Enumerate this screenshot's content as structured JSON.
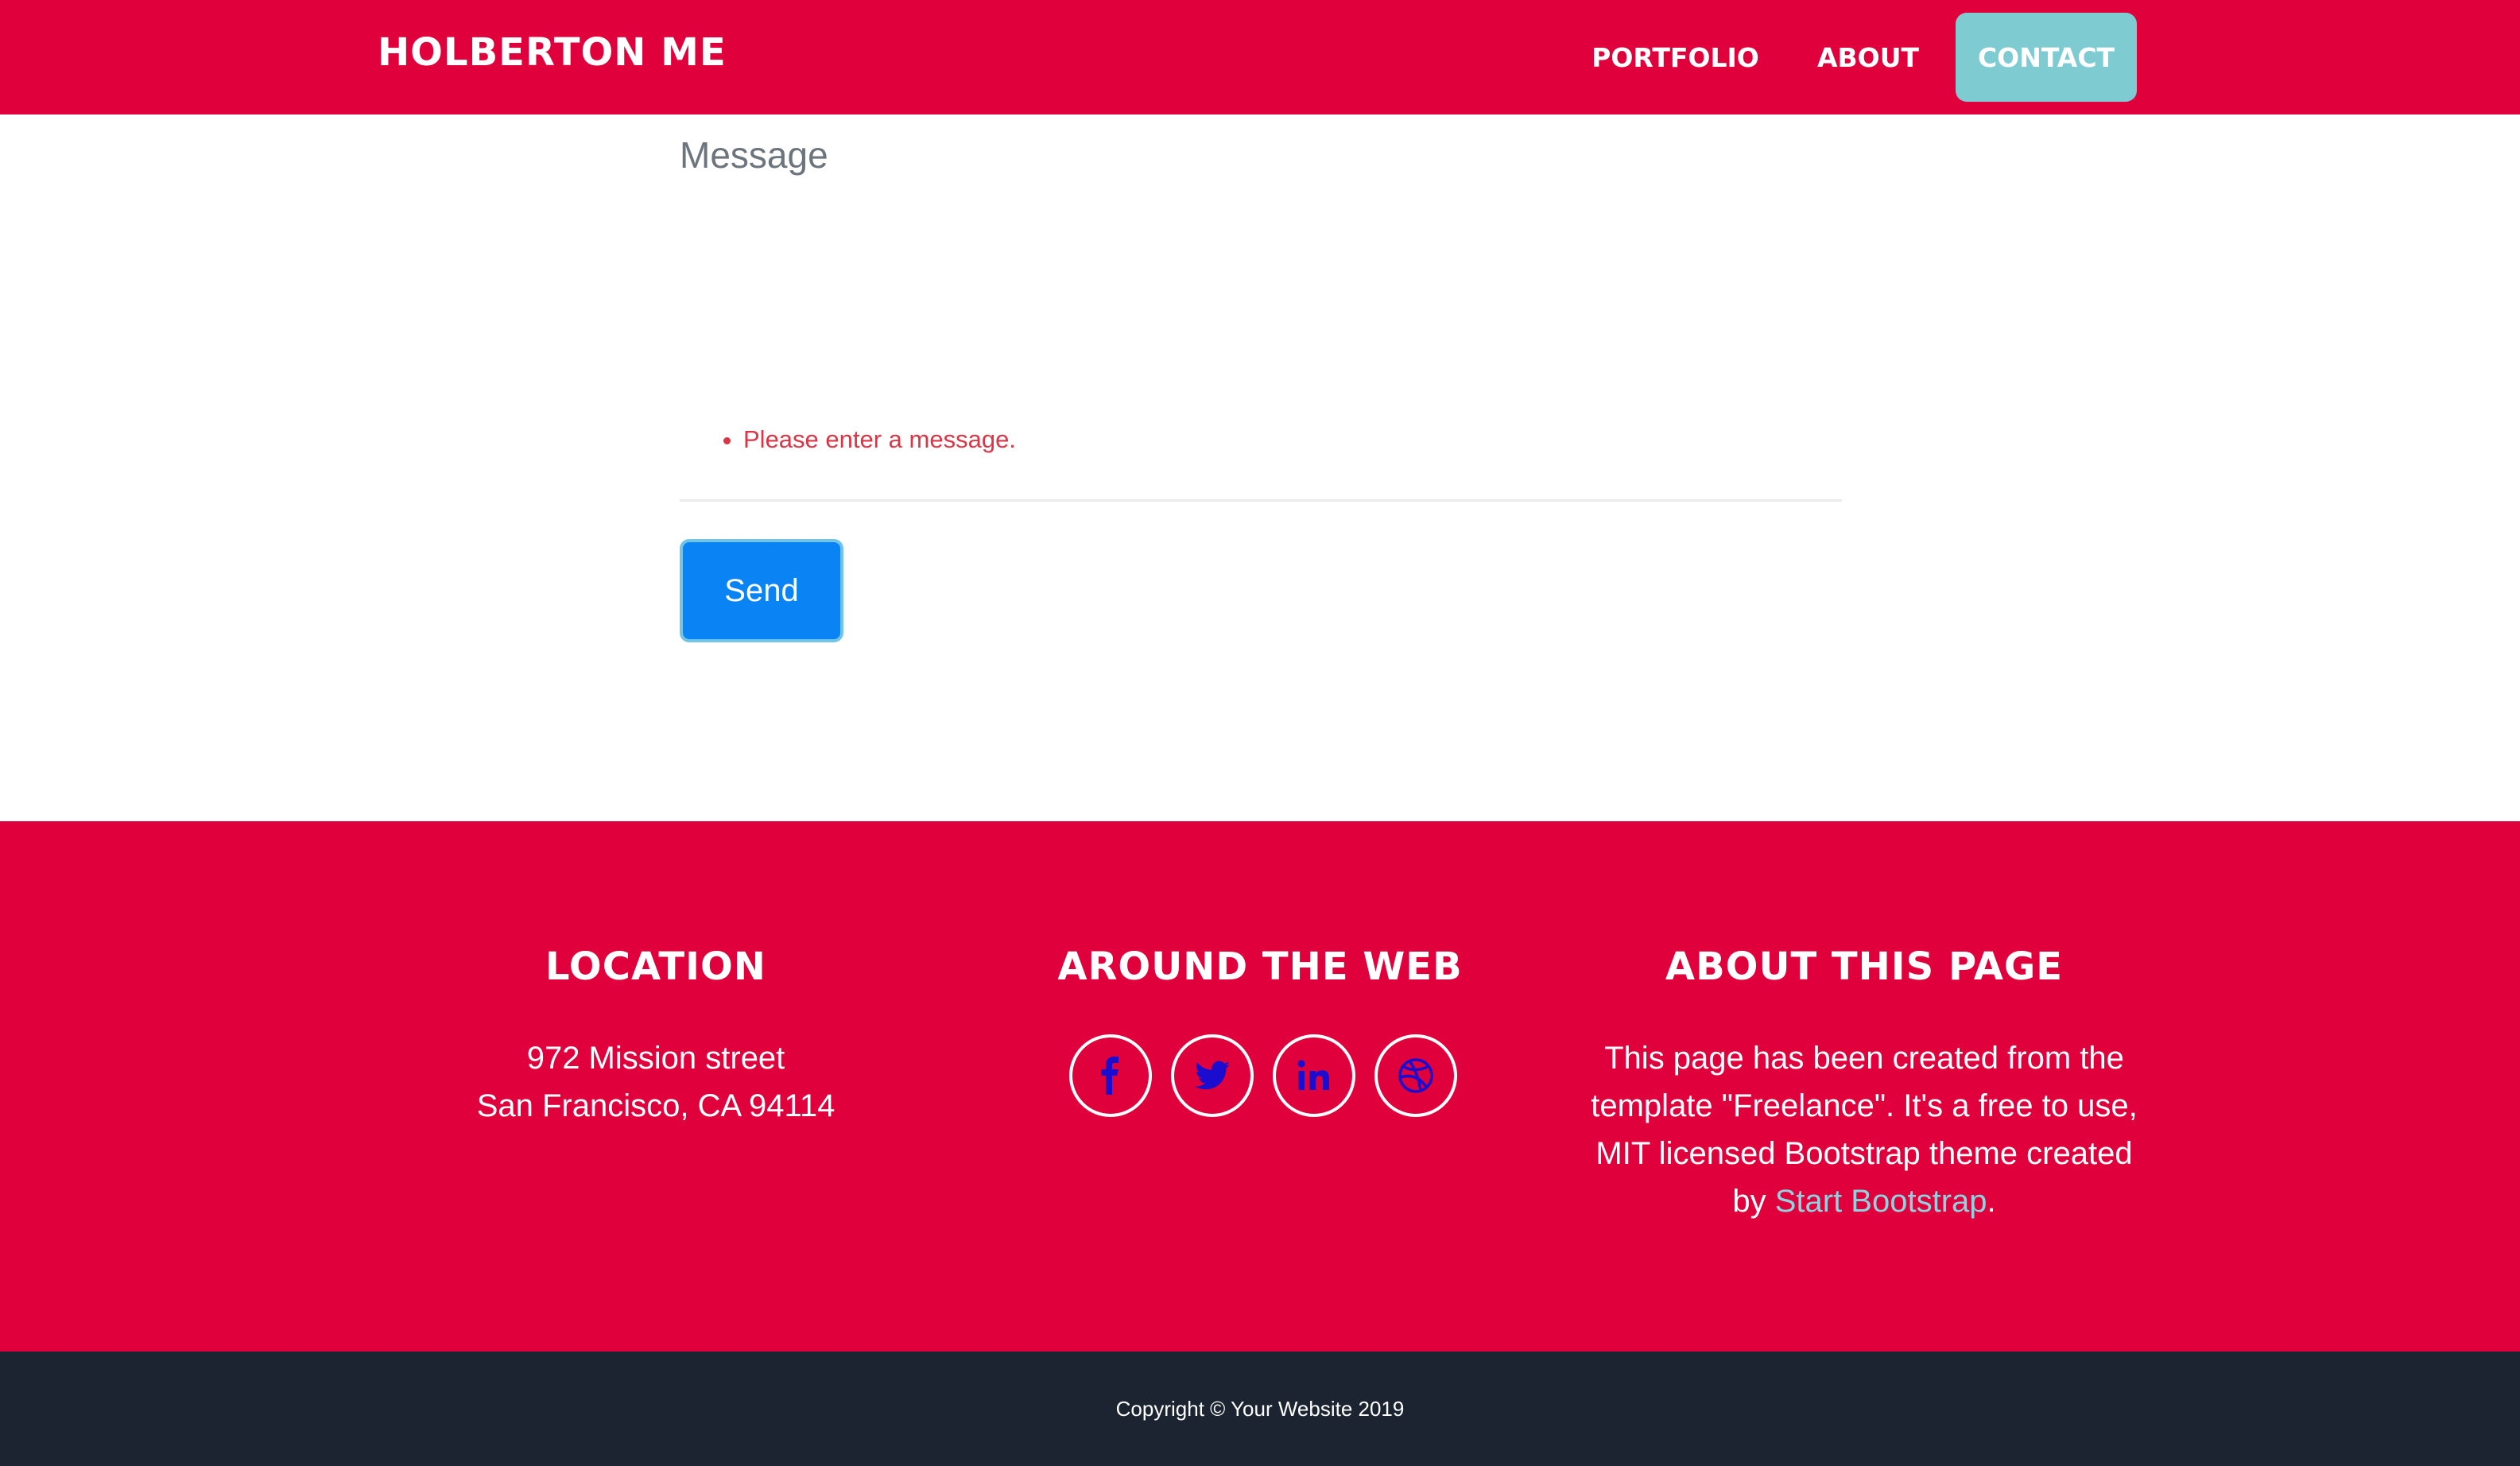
{
  "navbar": {
    "brand": "HOLBERTON ME",
    "items": [
      {
        "label": "PORTFOLIO",
        "active": false
      },
      {
        "label": "ABOUT",
        "active": false
      },
      {
        "label": "CONTACT",
        "active": true
      }
    ]
  },
  "form": {
    "message_placeholder": "Message",
    "message_value": "",
    "errors": [
      "Please enter a message."
    ],
    "send_label": "Send"
  },
  "footer": {
    "location": {
      "heading": "LOCATION",
      "line1": "972 Mission street",
      "line2": "San Francisco, CA 94114"
    },
    "web": {
      "heading": "AROUND THE WEB",
      "icons": [
        "facebook-icon",
        "twitter-icon",
        "linkedin-icon",
        "dribbble-icon"
      ]
    },
    "about": {
      "heading": "ABOUT THIS PAGE",
      "text": "This page has been created from the template \"Freelance\". It's a free to use, MIT licensed Bootstrap theme created by",
      "link": "Start Bootstrap",
      "after": "."
    }
  },
  "copyright": "Copyright © Your Website 2019",
  "colors": {
    "primary": "#e0003c",
    "accent": "#7ecbd2",
    "button": "#0a84f4",
    "dark": "#1b2430",
    "error": "#dc3545"
  }
}
